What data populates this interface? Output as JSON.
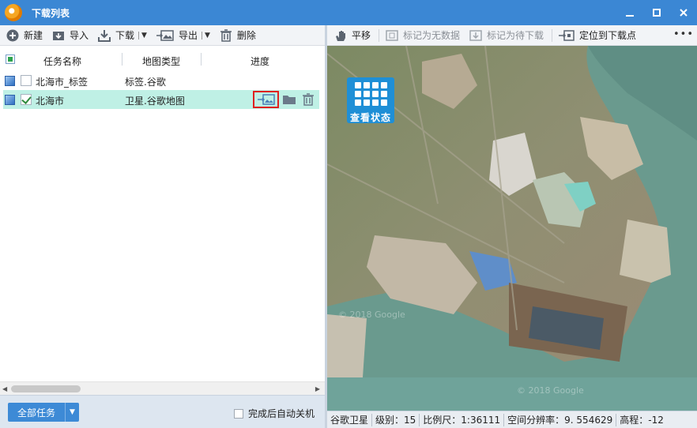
{
  "window": {
    "title": "下载列表"
  },
  "left_toolbar": {
    "new": "新建",
    "import": "导入",
    "download": "下载",
    "export": "导出",
    "delete": "删除"
  },
  "right_toolbar": {
    "pan": "平移",
    "mark_no_data": "标记为无数据",
    "mark_pending": "标记为待下载",
    "locate": "定位到下载点"
  },
  "list": {
    "headers": {
      "name": "任务名称",
      "type": "地图类型",
      "progress": "进度"
    },
    "rows": [
      {
        "name": "北海市_标签",
        "type": "标签.谷歌",
        "checked": false,
        "selected": false
      },
      {
        "name": "北海市",
        "type": "卫星.谷歌地图",
        "checked": true,
        "selected": true
      }
    ]
  },
  "bottom": {
    "all_tasks": "全部任务",
    "auto_shutdown": "完成后自动关机"
  },
  "map": {
    "status_button": "查看状态",
    "watermark": "© 2018 Google"
  },
  "statusbar": {
    "source": "谷歌卫星",
    "level": "级别：15",
    "scale": "比例尺：1:36111",
    "resolution": "空间分辨率：9. 554629",
    "elevation": "高程：-12"
  }
}
